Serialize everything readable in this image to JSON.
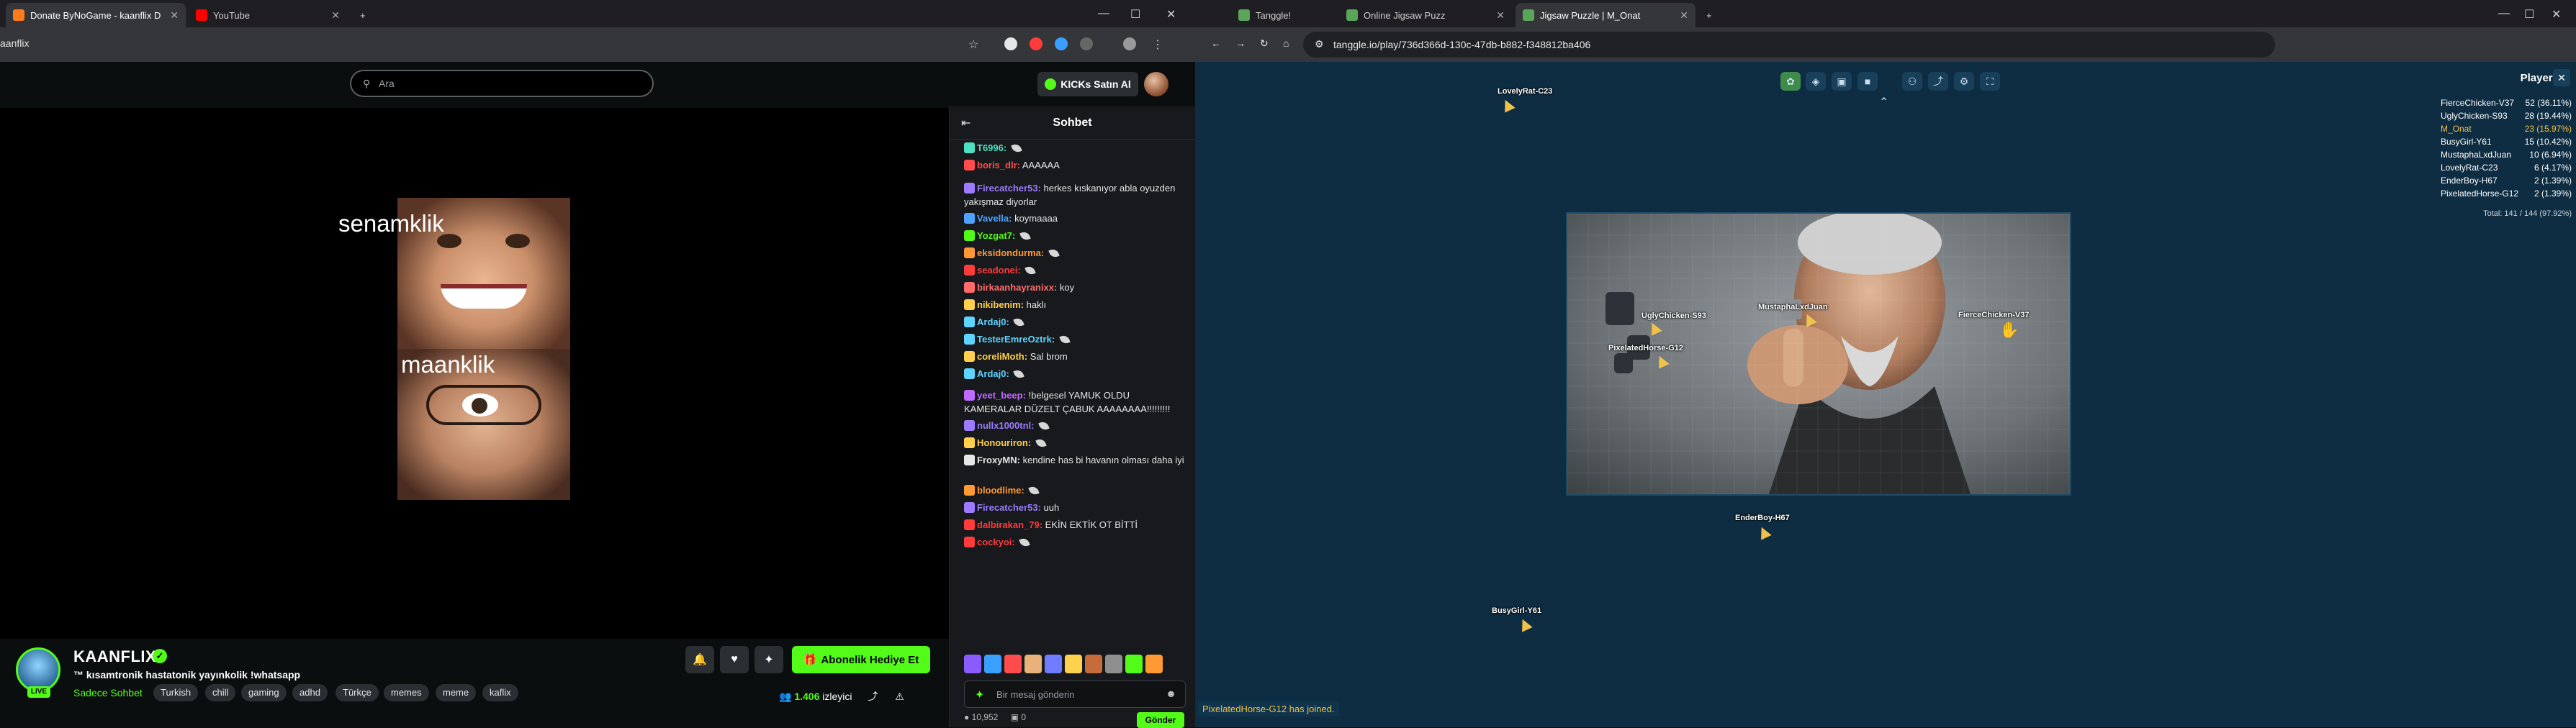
{
  "left_browser": {
    "tabs": [
      {
        "label": "Donate ByNoGame - kaanflix D",
        "active": true
      },
      {
        "label": "YouTube",
        "active": false
      }
    ],
    "new_tab": "+",
    "url": "aanflix"
  },
  "kick": {
    "search_placeholder": "Ara",
    "kicks_button": "KICKs Satın Al",
    "cam_labels": [
      "senamklik",
      "maanklik"
    ],
    "chat": {
      "title": "Sohbet",
      "messages": [
        {
          "user": "T6996:",
          "text": "",
          "color": "#4ee0c2"
        },
        {
          "user": "boris_dlr:",
          "text": "AAAAAA",
          "color": "#ff4d4d"
        },
        {
          "user": "Firecatcher53:",
          "text": "herkes kıskanıyor abla oyuzden yakışmaz diyorlar",
          "color": "#9d7bff"
        },
        {
          "user": "Vavella:",
          "text": "koymaaaa",
          "color": "#4ea3ff"
        },
        {
          "user": "Yozgat7:",
          "text": "",
          "color": "#53fc18"
        },
        {
          "user": "eksidondurma:",
          "text": "",
          "color": "#ff9933"
        },
        {
          "user": "seadonei:",
          "text": "",
          "color": "#ff3b3b"
        },
        {
          "user": "birkaanhayranixx:",
          "text": "koy",
          "color": "#ff6b6b"
        },
        {
          "user": "nikibenim:",
          "text": "haklı",
          "color": "#ffcf4d"
        },
        {
          "user": "Ardaj0:",
          "text": "",
          "color": "#5ed5ff"
        },
        {
          "user": "TesterEmreOztrk:",
          "text": "",
          "color": "#5ed5ff"
        },
        {
          "user": "coreliMoth:",
          "text": "Sal brom",
          "color": "#ffcf4d"
        },
        {
          "user": "Ardaj0:",
          "text": "",
          "color": "#5ed5ff"
        },
        {
          "user": "yeet_beep:",
          "text": "!belgesel YAMUK OLDU KAMERALAR DÜZELT ÇABUK AAAAAAAA!!!!!!!!!",
          "color": "#c06bff"
        },
        {
          "user": "nullx1000tnl:",
          "text": "",
          "color": "#9d7bff"
        },
        {
          "user": "Honouriron:",
          "text": "",
          "color": "#ffcf4d"
        },
        {
          "user": "FroxyMN:",
          "text": "kendine has bi havanın olması daha iyi",
          "color": "#e6e6e6"
        },
        {
          "user": "bloodlime:",
          "text": "",
          "color": "#ff9933"
        },
        {
          "user": "Firecatcher53:",
          "text": "uuh",
          "color": "#9d7bff"
        },
        {
          "user": "dalbirakan_79:",
          "text": "EKİN EKTİK OT BİTTİ",
          "color": "#ff3b3b"
        },
        {
          "user": "cockyoi:",
          "text": "",
          "color": "#ff3b3b"
        }
      ],
      "input_placeholder": "Bir mesaj gönderin",
      "send_label": "Gönder",
      "footer_count": "10,952",
      "footer_count2": "0"
    },
    "channel": {
      "name": "KAANFLIX",
      "live": "LIVE",
      "title": "™ kısamtronik hastatonik yayınkolik !whatsapp",
      "category": "Sadece Sohbet",
      "tags": [
        "Turkish",
        "chill",
        "gaming",
        "adhd",
        "Türkçe",
        "memes",
        "meme",
        "kaflix"
      ],
      "sub_button": "Abonelik Hediye Et",
      "viewers_count": "1.406",
      "viewers_label": "izleyici"
    }
  },
  "right_browser": {
    "tabs": [
      {
        "label": "Tanggle!",
        "active": false
      },
      {
        "label": "Online Jigsaw Puzz",
        "active": false
      },
      {
        "label": "Jigsaw Puzzle | M_Onat",
        "active": true
      }
    ],
    "new_tab": "+",
    "url": "tanggle.io/play/736d366d-130c-47db-b882-f348812ba406"
  },
  "game": {
    "players_title": "Players",
    "players": [
      {
        "name": "FierceChicken-V37",
        "score": "52 (36.11%)",
        "me": false
      },
      {
        "name": "UglyChicken-S93",
        "score": "28 (19.44%)",
        "me": false
      },
      {
        "name": "M_Onat",
        "score": "23 (15.97%)",
        "me": true
      },
      {
        "name": "BusyGirl-Y61",
        "score": "15 (10.42%)",
        "me": false
      },
      {
        "name": "MustaphaLxdJuan",
        "score": "10 (6.94%)",
        "me": false
      },
      {
        "name": "LovelyRat-C23",
        "score": "6 (4.17%)",
        "me": false
      },
      {
        "name": "EnderBoy-H67",
        "score": "2 (1.39%)",
        "me": false
      },
      {
        "name": "PixelatedHorse-G12",
        "score": "2 (1.39%)",
        "me": false
      }
    ],
    "total": "Total: 141 / 144 (97.92%)",
    "cursors": [
      "LovelyRat-C23",
      "UglyChicken-S93",
      "MustaphaLxdJuan",
      "FierceChicken-V37",
      "PixelatedHorse-G12",
      "EnderBoy-H67",
      "BusyGirl-Y61"
    ],
    "status_message": "PixelatedHorse-G12 has joined."
  }
}
